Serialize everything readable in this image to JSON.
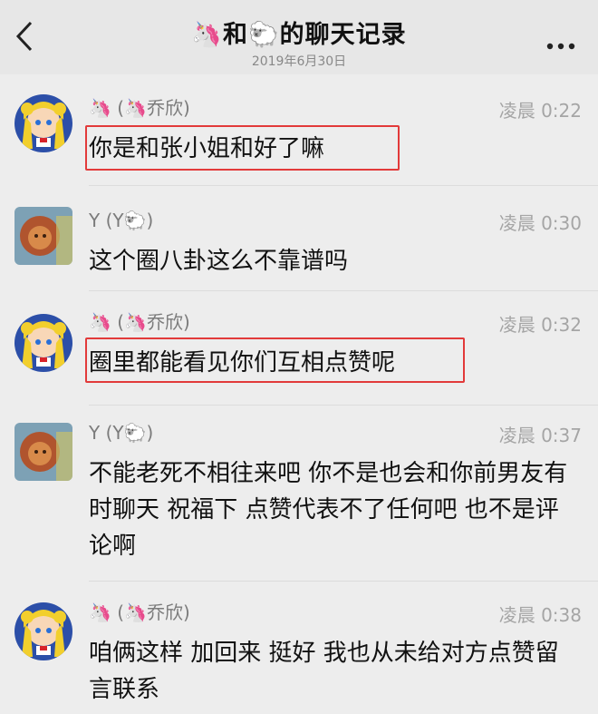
{
  "header": {
    "title": "🦄和🐑的聊天记录",
    "subtitle": "2019年6月30日",
    "back_icon": "chevron-left-icon",
    "more_icon": "more-horizontal-icon"
  },
  "messages": [
    {
      "name": "🦄 (🦄乔欣)",
      "time": "凌晨 0:22",
      "text": "你是和张小姐和好了嘛",
      "avatar": "sailor-moon-avatar",
      "highlighted": true
    },
    {
      "name": "Y (Y🐑)",
      "time": "凌晨 0:30",
      "text": "这个圈八卦这么不靠谱吗",
      "avatar": "lion-avatar",
      "highlighted": false
    },
    {
      "name": "🦄 (🦄乔欣)",
      "time": "凌晨 0:32",
      "text": "圈里都能看见你们互相点赞呢",
      "avatar": "sailor-moon-avatar",
      "highlighted": true
    },
    {
      "name": "Y (Y🐑)",
      "time": "凌晨 0:37",
      "text": "不能老死不相往来吧 你不是也会和你前男友有时聊天 祝福下 点赞代表不了任何吧 也不是评论啊",
      "avatar": "lion-avatar",
      "highlighted": false
    },
    {
      "name": "🦄 (🦄乔欣)",
      "time": "凌晨 0:38",
      "text": "咱俩这样 加回来 挺好  我也从未给对方点赞留言联系",
      "avatar": "sailor-moon-avatar",
      "highlighted": false
    }
  ],
  "colors": {
    "highlight": "#e23a3a",
    "background": "#ededed"
  }
}
